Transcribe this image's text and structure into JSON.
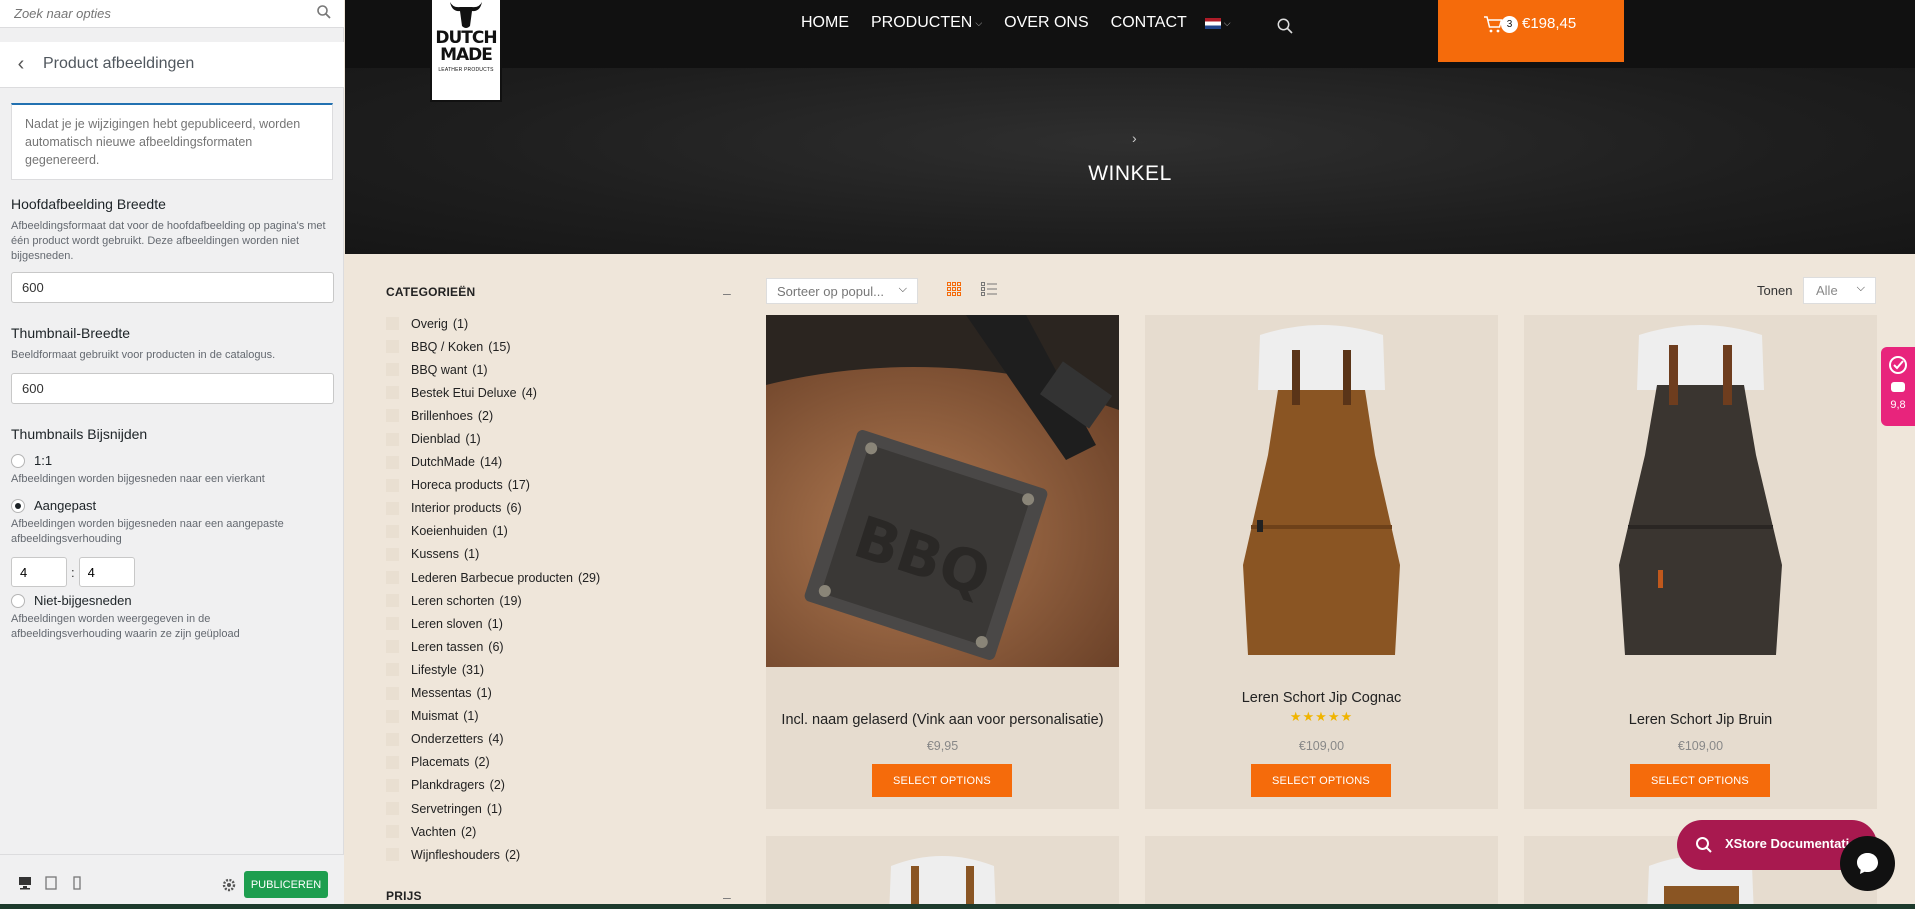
{
  "customizer": {
    "search_placeholder": "Zoek naar opties",
    "section_title": "Product afbeeldingen",
    "notice": "Nadat je je wijzigingen hebt gepubliceerd, worden automatisch nieuwe afbeeldingsformaten gegenereerd.",
    "main_width": {
      "label": "Hoofdafbeelding Breedte",
      "description": "Afbeeldingsformaat dat voor de hoofdafbeelding op pagina's met één product wordt gebruikt. Deze afbeeldingen worden niet bijgesneden.",
      "value": "600"
    },
    "thumb_width": {
      "label": "Thumbnail-Breedte",
      "description": "Beeldformaat gebruikt voor producten in de catalogus.",
      "value": "600"
    },
    "crop": {
      "label": "Thumbnails Bijsnijden",
      "options": [
        {
          "label": "1:1",
          "description": "Afbeeldingen worden bijgesneden naar een vierkant",
          "checked": false
        },
        {
          "label": "Aangepast",
          "description": "Afbeeldingen worden bijgesneden naar een aangepaste afbeeldingsverhouding",
          "checked": true
        },
        {
          "label": "Niet-bijgesneden",
          "description": "Afbeeldingen worden weergegeven in de afbeeldingsverhouding waarin ze zijn geüpload",
          "checked": false
        }
      ],
      "ratio_w": "4",
      "ratio_sep": ":",
      "ratio_h": "4"
    },
    "publish_label": "PUBLICEREN",
    "back_icon": "chevron-left-icon"
  },
  "site": {
    "logo": {
      "line1": "DUTCH",
      "line2": "MADE",
      "line3": "LEATHER PRODUCTS"
    },
    "nav": [
      {
        "label": "HOME"
      },
      {
        "label": "PRODUCTEN"
      },
      {
        "label": "OVER ONS"
      },
      {
        "label": "CONTACT"
      }
    ],
    "cart": {
      "count": "3",
      "total": "€198,45"
    },
    "breadcrumb_sep": "›",
    "page_title": "WINKEL",
    "colors": {
      "accent": "#f56b0b",
      "header": "#111111",
      "background": "#efe6da",
      "rating": "#e8247c"
    }
  },
  "filters": {
    "categories_title": "CATEGORIEËN",
    "collapse_symbol": "–",
    "categories": [
      {
        "name": "Overig",
        "count": "(1)"
      },
      {
        "name": "BBQ / Koken",
        "count": "(15)"
      },
      {
        "name": "BBQ want",
        "count": "(1)"
      },
      {
        "name": "Bestek Etui Deluxe",
        "count": "(4)"
      },
      {
        "name": "Brillenhoes",
        "count": "(2)"
      },
      {
        "name": "Dienblad",
        "count": "(1)"
      },
      {
        "name": "DutchMade",
        "count": "(14)"
      },
      {
        "name": "Horeca products",
        "count": "(17)"
      },
      {
        "name": "Interior products",
        "count": "(6)"
      },
      {
        "name": "Koeienhuiden",
        "count": "(1)"
      },
      {
        "name": "Kussens",
        "count": "(1)"
      },
      {
        "name": "Lederen Barbecue producten",
        "count": "(29)"
      },
      {
        "name": "Leren schorten",
        "count": "(19)"
      },
      {
        "name": "Leren sloven",
        "count": "(1)"
      },
      {
        "name": "Leren tassen",
        "count": "(6)"
      },
      {
        "name": "Lifestyle",
        "count": "(31)"
      },
      {
        "name": "Messentas",
        "count": "(1)"
      },
      {
        "name": "Muismat",
        "count": "(1)"
      },
      {
        "name": "Onderzetters",
        "count": "(4)"
      },
      {
        "name": "Placemats",
        "count": "(2)"
      },
      {
        "name": "Plankdragers",
        "count": "(2)"
      },
      {
        "name": "Servetringen",
        "count": "(1)"
      },
      {
        "name": "Vachten",
        "count": "(2)"
      },
      {
        "name": "Wijnfleshouders",
        "count": "(2)"
      }
    ],
    "price_title": "PRIJS"
  },
  "toolbar": {
    "sort_value": "Sorteer op popul...",
    "show_label": "Tonen",
    "show_value": "Alle"
  },
  "products": [
    {
      "name": "Incl. naam gelaserd (Vink aan voor personalisatie)",
      "price": "€9,95",
      "button": "SELECT OPTIONS",
      "rating": null
    },
    {
      "name": "Leren Schort Jip Cognac",
      "price": "€109,00",
      "button": "SELECT OPTIONS",
      "rating": 5
    },
    {
      "name": "Leren Schort Jip Bruin",
      "price": "€109,00",
      "button": "SELECT OPTIONS",
      "rating": null
    }
  ],
  "widgets": {
    "rating_score": "9,8",
    "xstore_label": "XStore Documentation"
  }
}
